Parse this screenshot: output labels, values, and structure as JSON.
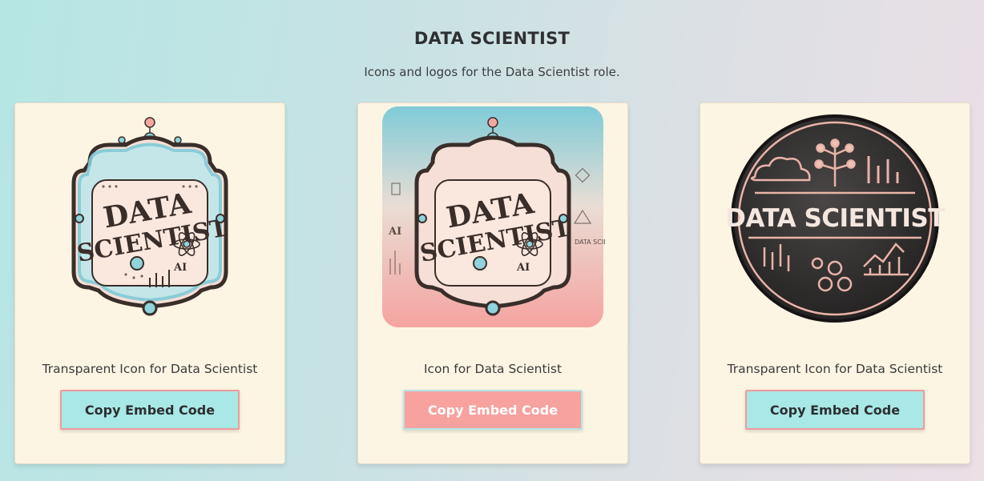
{
  "header": {
    "title": "DATA SCIENTIST",
    "subtitle": "Icons and logos for the Data Scientist role."
  },
  "cards": [
    {
      "image_text": {
        "line1": "DATA",
        "line2": "SCIENTIST",
        "tag": "AI"
      },
      "caption": "Transparent Icon for Data Scientist",
      "button_label": "Copy Embed Code",
      "button_style": {
        "background": "#a8e8e6",
        "border": "#ee9c9c",
        "text": "#2d2e31"
      }
    },
    {
      "image_text": {
        "line1": "DATA",
        "line2": "SCIENTIST",
        "tag": "AI",
        "side_tag": "AI",
        "side_text": "DATA SCIENCE"
      },
      "caption": "Icon for Data Scientist",
      "button_label": "Copy Embed Code",
      "button_style": {
        "background": "#f7a29f",
        "border": "#b2e6e6",
        "text": "#ffffff"
      }
    },
    {
      "image_text": {
        "line1": "DATA SCIENTIST"
      },
      "caption": "Transparent Icon for Data Scientist",
      "button_label": "Copy Embed Code",
      "button_style": {
        "background": "#a8e8e6",
        "border": "#ee9c9c",
        "text": "#2d2e31"
      }
    }
  ],
  "icons": [
    "network-icon",
    "atom-icon",
    "cloud-icon",
    "bar-chart-icon",
    "tree-icon"
  ],
  "colors": {
    "card_bg": "#fdf5e3",
    "teal": "#7fcbd8",
    "salmon": "#f3a6a0",
    "badge_dark": "#2b2a2a"
  }
}
